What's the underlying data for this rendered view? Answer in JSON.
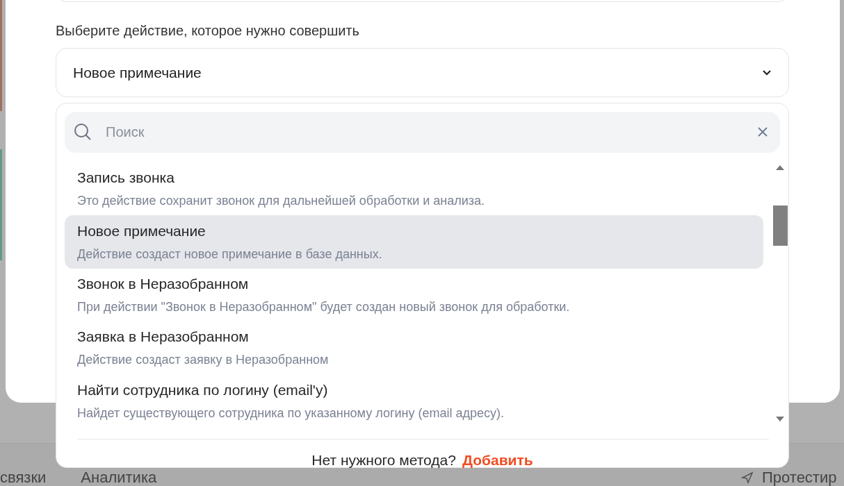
{
  "background": {
    "tabs": [
      {
        "label": "связки"
      },
      {
        "label": "Аналитика"
      }
    ],
    "action_button": {
      "label": "Протестир"
    }
  },
  "modal": {
    "action_label": "Выберите действие, которое нужно совершить",
    "select": {
      "value": "Новое примечание",
      "expanded": true
    },
    "dropdown": {
      "search": {
        "placeholder": "Поиск"
      },
      "items": [
        {
          "title": "Запись звонка",
          "description": "Это действие сохранит звонок для дальнейшей обработки и анализа.",
          "selected": false
        },
        {
          "title": "Новое примечание",
          "description": "Действие создаст новое примечание в базе данных.",
          "selected": true
        },
        {
          "title": "Звонок в Неразобранном",
          "description": "При действии \"Звонок в Неразобранном\" будет создан новый звонок для обработки.",
          "selected": false
        },
        {
          "title": "Заявка в Неразобранном",
          "description": "Действие создаст заявку в Неразобранном",
          "selected": false
        },
        {
          "title": "Найти сотрудника по логину (email'у)",
          "description": "Найдет существующего сотрудника по указанному логину (email адресу).",
          "selected": false
        }
      ],
      "footer": {
        "text": "Нет нужного метода?",
        "link": "Добавить"
      }
    }
  }
}
